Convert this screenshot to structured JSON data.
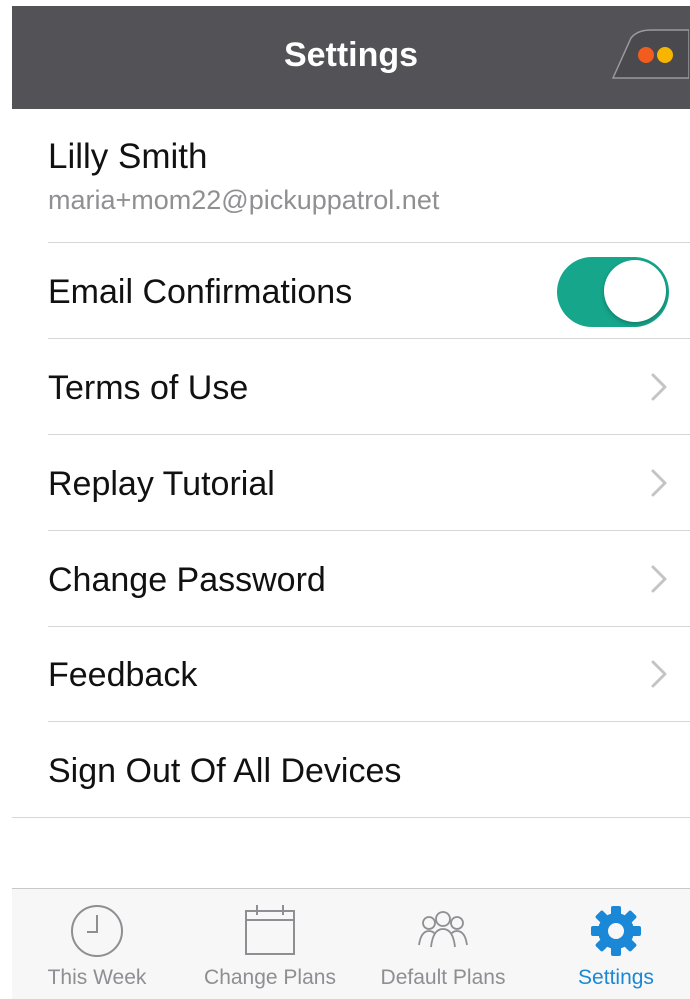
{
  "nav": {
    "title": "Settings",
    "logo_icon": "car-headlights-icon",
    "bar_color": "#535357"
  },
  "profile": {
    "name": "Lilly Smith",
    "email": "maria+mom22@pickuppatrol.net"
  },
  "settings_rows": [
    {
      "label": "Email Confirmations",
      "control": "toggle",
      "toggle_on": true
    },
    {
      "label": "Terms of Use",
      "control": "chevron"
    },
    {
      "label": "Replay Tutorial",
      "control": "chevron"
    },
    {
      "label": "Change Password",
      "control": "chevron"
    },
    {
      "label": "Feedback",
      "control": "chevron"
    },
    {
      "label": "Sign Out Of All Devices",
      "control": "none"
    }
  ],
  "tabs": [
    {
      "label": "This Week",
      "icon": "clock-icon",
      "active": false
    },
    {
      "label": "Change Plans",
      "icon": "calendar-icon",
      "active": false
    },
    {
      "label": "Default Plans",
      "icon": "people-group-icon",
      "active": false
    },
    {
      "label": "Settings",
      "icon": "gear-icon",
      "active": true
    }
  ],
  "colors": {
    "accent_toggle": "#15a68b",
    "active_tab": "#1a88d6",
    "inactive_tab": "#8e8e93"
  }
}
